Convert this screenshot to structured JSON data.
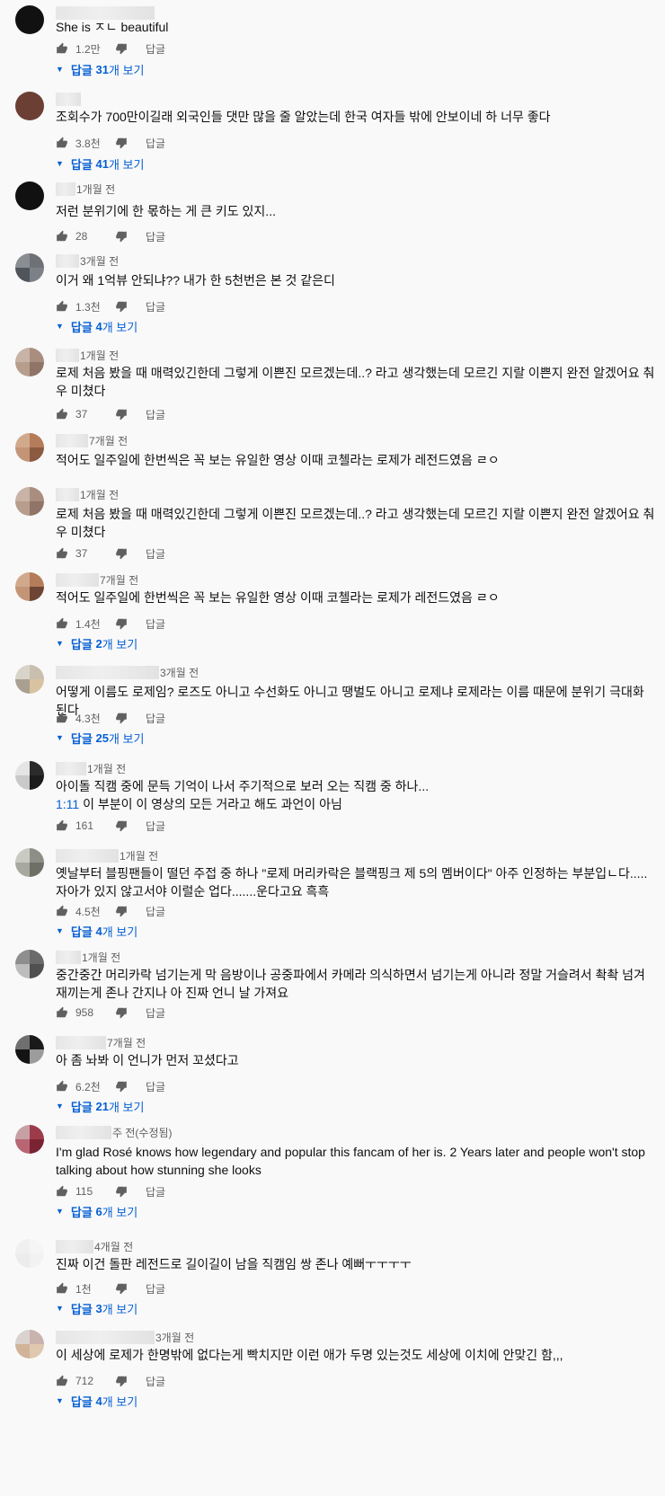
{
  "labels": {
    "reply": "답글"
  },
  "comments": [
    {
      "time": "",
      "text": "She is ㅈㄴ beautiful",
      "likes": "1.2만",
      "replies_count": "31",
      "avatar": [
        "#111111",
        "#111111",
        "#111111",
        "#111111"
      ]
    },
    {
      "time": "",
      "text": "조회수가 700만이길래 외국인들 댓만 많을 줄 알았는데 한국 여자들 밖에 안보이네 하 너무 좋다",
      "likes": "3.8천",
      "replies_count": "41",
      "avatar": [
        "#6b3f34",
        "#6b3f34",
        "#6b3f34",
        "#6b3f34"
      ]
    },
    {
      "time": "1개월 전",
      "text": "저런 분위기에 한 몫하는 게 큰 키도 있지...",
      "likes": "28",
      "replies_count": "",
      "avatar": [
        "#111111",
        "#111111",
        "#111111",
        "#111111"
      ]
    },
    {
      "time": "3개월 전",
      "text": "이거 왜 1억뷰 안되냐?? 내가 한 5천번은 본 것 같은디",
      "likes": "1.3천",
      "replies_count": "4",
      "avatar": [
        "#8a8d91",
        "#6e7276",
        "#4f555b",
        "#7b8187"
      ]
    },
    {
      "time": "1개월 전",
      "text": "로제 처음 봤을 때 매력있긴한데 그렇게 이쁜진 모르겠는데..? 라고 생각했는데 모르긴 지랄 이쁜지 완전 알겠어요 춰우 미쳤다",
      "likes": "37",
      "replies_count": "",
      "avatar": [
        "#c8b3a6",
        "#a98e80",
        "#b79d8c",
        "#8f7467"
      ]
    },
    {
      "time": "7개월 전",
      "text": "적어도 일주일에 한번씩은 꼭 보는 유일한 영상 이때 코첼라는 로제가 레전드였음 ㄹㅇ",
      "likes": "",
      "replies_count": "",
      "avatar": [
        "#d1a98c",
        "#b57c5a",
        "#c49477",
        "#8b5a40"
      ]
    },
    {
      "time": "1개월 전",
      "text": "로제 처음 봤을 때 매력있긴한데 그렇게 이쁜진 모르겠는데..? 라고 생각했는데 모르긴 지랄 이쁜지 완전 알겠어요 춰우 미쳤다",
      "likes": "37",
      "replies_count": "",
      "avatar": [
        "#c8b3a6",
        "#a98e80",
        "#b79d8c",
        "#8f7467"
      ]
    },
    {
      "time": "7개월 전",
      "text": "적어도 일주일에 한번씩은 꼭 보는 유일한 영상 이때 코첼라는 로제가 레전드였음 ㄹㅇ",
      "likes": "1.4천",
      "replies_count": "2",
      "avatar": [
        "#d1a98c",
        "#b57c5a",
        "#c49477",
        "#6e4534"
      ]
    },
    {
      "time": "3개월 전",
      "text": "어떻게 이름도 로제임? 로즈도 아니고 수선화도 아니고 땡벌도 아니고 로제냐 로제라는 이름 때문에 분위기 극대화 된다",
      "likes": "4.3천",
      "replies_count": "25",
      "avatar": [
        "#d9d4c9",
        "#c9bfae",
        "#a9a091",
        "#d8c2a0"
      ]
    },
    {
      "time": "1개월 전",
      "text": "아이돌 직캠 중에 문득 기억이 나서 주기적으로 보러 오는 직캠 중 하나...",
      "text_ts": "1:11",
      "text_after": "이 부분이 이 영상의 모든 거라고 해도 과언이 아님",
      "likes": "161",
      "replies_count": "",
      "avatar": [
        "#e4e4e4",
        "#2b2b2b",
        "#c9c9c9",
        "#1c1c1c"
      ]
    },
    {
      "time": "1개월 전",
      "text": "옛날부터 블핑팬들이 떨던 주접 중 하나 \"로제 머리카락은 블랙핑크 제 5의 멤버이다\" 아주 인정하는 부분입ㄴ다..... 자아가 있지 않고서야 이럴순 업다.......운다고요 흑흑",
      "likes": "4.5천",
      "replies_count": "4",
      "avatar": [
        "#c9cbc3",
        "#8d8f86",
        "#a7a99f",
        "#6e7068"
      ]
    },
    {
      "time": "1개월 전",
      "text": "중간중간 머리카락 넘기는게 막 음방이나 공중파에서 카메라 의식하면서 넘기는게 아니라 정말 거슬려서 촥촥 넘겨 재끼는게 존나 간지나 아 진짜 언니 날 가져요",
      "likes": "958",
      "replies_count": "",
      "avatar": [
        "#8e8e8e",
        "#6a6a6a",
        "#bdbdbd",
        "#505050"
      ]
    },
    {
      "time": "7개월 전",
      "text": "아 좀 놔봐 이 언니가 먼저 꼬셨다고",
      "likes": "6.2천",
      "replies_count": "21",
      "avatar": [
        "#6f6f6f",
        "#1a1a1a",
        "#141414",
        "#9c9c9c"
      ]
    },
    {
      "time": "주 전(수정됨)",
      "text": "I'm glad Rosé knows how legendary and popular this fancam of her is. 2 Years later and people won't stop talking about how stunning she looks",
      "likes": "115",
      "replies_count": "6",
      "avatar": [
        "#c7a0a6",
        "#9e3b4a",
        "#b86574",
        "#7a2333"
      ]
    },
    {
      "time": "4개월 전",
      "text": "진짜 이건 돌판 레전드로 길이길이 남을 직캠임 쌍 존나 예뻐ㅜㅜㅜㅜ",
      "likes": "1천",
      "replies_count": "3",
      "avatar": [
        "#f0f0f0",
        "#f5f5f5",
        "#ececec",
        "#f2f2f2"
      ]
    },
    {
      "time": "3개월 전",
      "text": "이 세상에 로제가 한명밖에 없다는게 빡치지만 이런 애가 두명 있는것도 세상에 이치에 안맞긴 함,,,",
      "likes": "712",
      "replies_count": "4",
      "avatar": [
        "#d9d2cf",
        "#c9b3ad",
        "#d1b39a",
        "#e0c8b0"
      ]
    }
  ]
}
